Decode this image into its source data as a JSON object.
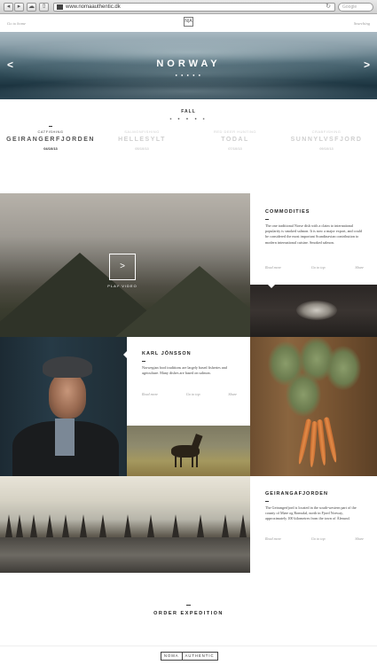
{
  "browser": {
    "back_icon": "arrow-left-icon",
    "forward_icon": "arrow-right-icon",
    "url": "www.nomaauthentic.dk",
    "search_placeholder": "Google"
  },
  "topbar": {
    "left_link": "Go to home",
    "right_link": "Searching",
    "logo": "N|A"
  },
  "hero": {
    "title": "NORWAY",
    "dots": "● ● ● ● ●",
    "prev_icon": "<",
    "next_icon": ">"
  },
  "fall": {
    "season": "FALL",
    "pager": "◂ ● ● ● ▸",
    "events": [
      {
        "kind": "CATFISHING",
        "place": "GEIRANGERFJORDEN",
        "date": "04/10/13"
      },
      {
        "kind": "SALMONFISHING",
        "place": "HELLESYLT",
        "date": "05/10/13"
      },
      {
        "kind": "RED DEER HUNTING",
        "place": "TODAL",
        "date": "07/10/13"
      },
      {
        "kind": "CRABFISHING",
        "place": "SUNNYLVSFJORD",
        "date": "09/10/13"
      }
    ]
  },
  "video": {
    "play_icon": ">",
    "label": "PLAY VIDEO"
  },
  "commodities": {
    "title": "COMMODITIES",
    "text": "The one traditional Norse dish with a claim to international popularity is smoked salmon. It is now a major export, and could be considered the most important Scandinavian contribution to modern international cuisine. Smoked salmon.",
    "read_more": "Read more",
    "go_to_top": "Go to top",
    "share": "Share"
  },
  "karl": {
    "title": "KARL JÖNSSON",
    "text": "Norwegian food traditions are largely based fisheries and agriculture. Many dishes are based on salmon.",
    "read_more": "Read more",
    "go_to_top": "Go to top",
    "share": "Share"
  },
  "geiranger": {
    "title": "GEIRANGAFJORDEN",
    "text": "The Geirangerfjord is located in the south-western part of the county of Møre og Romsdal, north in Fjord Norway, approximately 100 kilometres from the town of Ålesund.",
    "read_more": "Read more",
    "go_to_top": "Go to top",
    "share": "Share"
  },
  "order": {
    "label": "ORDER EXPEDITION"
  },
  "footer": {
    "brand_left": "NOMA",
    "brand_right": "AUTHENTIC"
  }
}
